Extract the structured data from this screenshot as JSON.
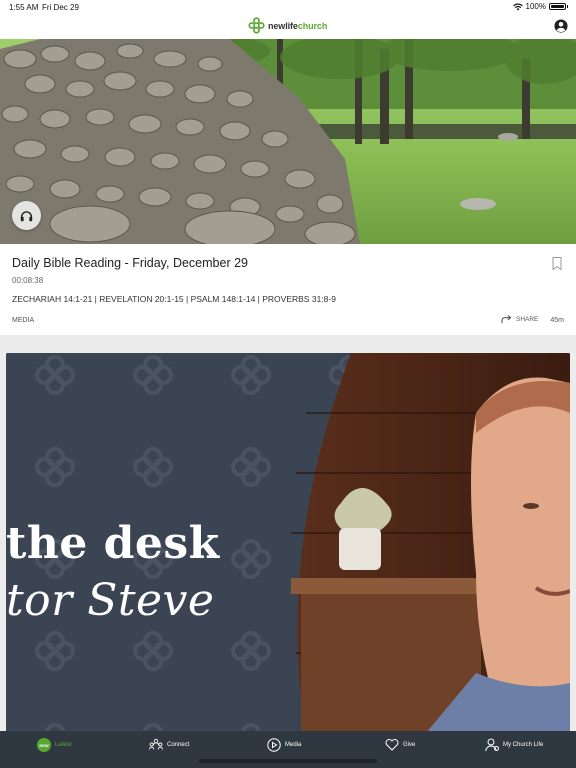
{
  "status_bar": {
    "time": "1:55 AM",
    "date": "Fri Dec 29",
    "battery": "100%",
    "battery_level": 1.0
  },
  "header": {
    "logo_prefix": "newlife",
    "logo_suffix": "church",
    "brand_color": "#5aa834",
    "profile_icon": "person-circle-icon"
  },
  "feed": {
    "card1": {
      "title": "Daily Bible Reading - Friday, December 29",
      "duration": "00:08:38",
      "scripture_refs": "ZECHARIAH 14:1-21 | REVELATION 20:1-15 | PSALM 148:1-14 | PROVERBS 31:8-9",
      "category": "MEDIA",
      "share_label": "SHARE",
      "age": "45m",
      "audio_icon": "headphones-icon",
      "bookmark_icon": "bookmark-icon"
    },
    "card2": {
      "line1": "the desk",
      "line2": "tor Steve"
    }
  },
  "tab_bar": {
    "badge": "NEW",
    "items": [
      {
        "label": "Latest",
        "icon": "new-badge-icon",
        "active": true
      },
      {
        "label": "Connect",
        "icon": "people-icon"
      },
      {
        "label": "Media",
        "icon": "play-circle-icon"
      },
      {
        "label": "Give",
        "icon": "heart-icon"
      },
      {
        "label": "My Church Life",
        "icon": "person-icon"
      }
    ]
  }
}
